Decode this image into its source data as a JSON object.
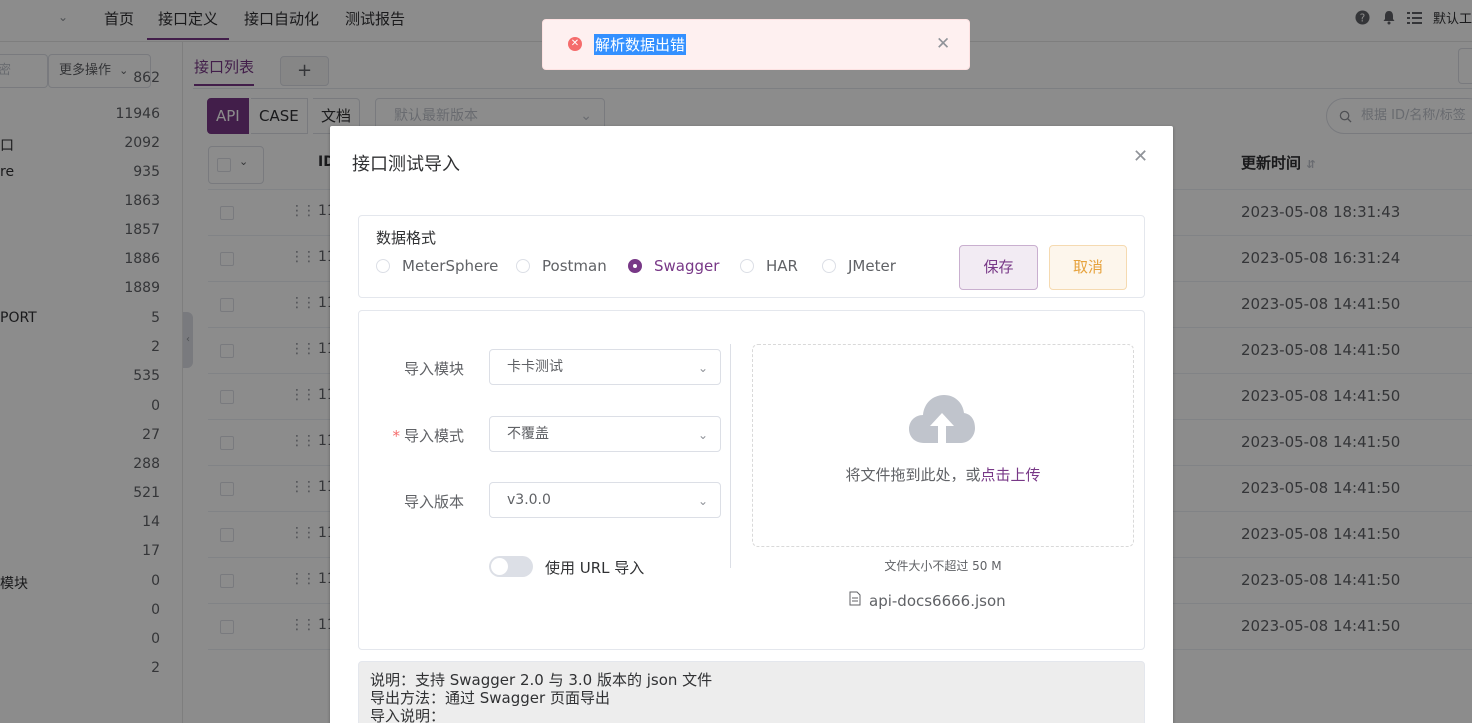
{
  "topnav": {
    "items": [
      "首页",
      "接口定义",
      "接口自动化",
      "测试报告"
    ],
    "active_index": 1,
    "user": "默认工"
  },
  "sidebar": {
    "search_fragment": "密",
    "more_button": "更多操作",
    "tree": [
      {
        "label": "",
        "count": "862"
      },
      {
        "label": "",
        "count": "11946"
      },
      {
        "label": "口",
        "count": "2092"
      },
      {
        "label": "re",
        "count": "935"
      },
      {
        "label": "",
        "count": "1863"
      },
      {
        "label": "",
        "count": "1857"
      },
      {
        "label": "",
        "count": "1886"
      },
      {
        "label": "",
        "count": "1889"
      },
      {
        "label": "PORT",
        "count": "5"
      },
      {
        "label": "",
        "count": "2"
      },
      {
        "label": "",
        "count": "535"
      },
      {
        "label": "",
        "count": "0"
      },
      {
        "label": "",
        "count": "27"
      },
      {
        "label": "",
        "count": "288"
      },
      {
        "label": "",
        "count": "521"
      },
      {
        "label": "",
        "count": "14"
      },
      {
        "label": "",
        "count": "17"
      },
      {
        "label": "模块",
        "count": "0"
      },
      {
        "label": "",
        "count": "0"
      },
      {
        "label": "",
        "count": "0"
      },
      {
        "label": "",
        "count": "2"
      }
    ]
  },
  "main": {
    "tab_label": "接口列表",
    "tab_add": "+",
    "segments": [
      "API",
      "CASE",
      "文档"
    ],
    "active_segment": 0,
    "version_placeholder": "默认最新版本",
    "search_placeholder": "根据 ID/名称/标签",
    "columns": {
      "id": "ID",
      "updated": "更新时间"
    },
    "rows": [
      {
        "id": "11",
        "time": "2023-05-08 18:31:43"
      },
      {
        "id": "11",
        "time": "2023-05-08 16:31:24"
      },
      {
        "id": "11",
        "time": "2023-05-08 14:41:50"
      },
      {
        "id": "11",
        "time": "2023-05-08 14:41:50"
      },
      {
        "id": "11",
        "time": "2023-05-08 14:41:50"
      },
      {
        "id": "11",
        "time": "2023-05-08 14:41:50"
      },
      {
        "id": "11",
        "time": "2023-05-08 14:41:50"
      },
      {
        "id": "11",
        "time": "2023-05-08 14:41:50"
      },
      {
        "id": "11",
        "time": "2023-05-08 14:41:50"
      },
      {
        "id": "11",
        "time": "2023-05-08 14:41:50"
      }
    ]
  },
  "dialog": {
    "title": "接口测试导入",
    "format_label": "数据格式",
    "formats": [
      "MeterSphere",
      "Postman",
      "Swagger",
      "HAR",
      "JMeter"
    ],
    "selected_format": 2,
    "save": "保存",
    "cancel": "取消",
    "module_label": "导入模块",
    "module_value": "卡卡测试",
    "mode_label": "导入模式",
    "mode_value": "不覆盖",
    "version_label": "导入版本",
    "version_value": "v3.0.0",
    "url_toggle_label": "使用 URL 导入",
    "upload_text": "将文件拖到此处，或",
    "upload_link": "点击上传",
    "upload_tip": "文件大小不超过 50 M",
    "file_name": "api-docs6666.json",
    "note_lines": [
      "说明：支持 Swagger 2.0 与 3.0 版本的 json 文件",
      "导出方法：通过 Swagger 页面导出",
      "导入说明："
    ]
  },
  "message": {
    "text": "解析数据出错",
    "type": "error"
  },
  "colors": {
    "primary": "#783887",
    "error": "#f56c6c",
    "warning": "#e6a23c"
  }
}
